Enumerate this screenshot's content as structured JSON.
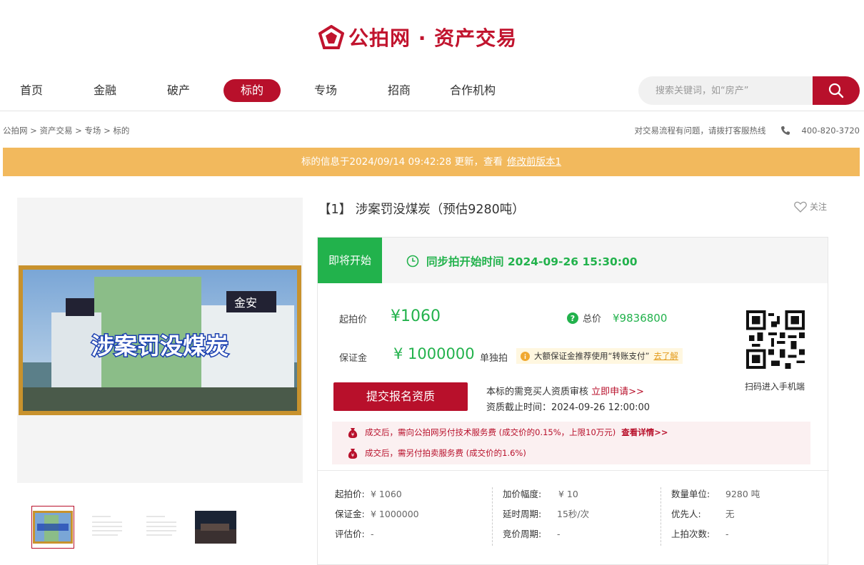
{
  "brand": {
    "logo_text": "公拍网 · 资产交易",
    "accent": "#b8102b",
    "green": "#22b24c",
    "notice_bg": "#f2b95d"
  },
  "nav": {
    "items": [
      {
        "label": "首页"
      },
      {
        "label": "金融"
      },
      {
        "label": "破产"
      },
      {
        "label": "标的",
        "active": true
      },
      {
        "label": "专场"
      },
      {
        "label": "招商"
      },
      {
        "label": "合作机构"
      }
    ],
    "search_placeholder": "搜索关键词，如“房产”"
  },
  "breadcrumb": {
    "items": [
      "公拍网",
      ">",
      "资产交易",
      ">",
      "专场",
      ">",
      "标的"
    ],
    "hotline_text": "对交易流程有问题，请拨打客服热线",
    "phone": "400-820-3720"
  },
  "notice": {
    "text": "标的信息于2024/09/14 09:42:28 更新，查看",
    "link": "修改前版本1"
  },
  "gallery": {
    "main_caption": "涉案罚没煤炭",
    "ship_sign": "金安",
    "thumb_count": 4
  },
  "lot": {
    "title": "【1】 涉案罚没煤炭（预估9280吨）",
    "follow_label": "关注",
    "status": "即将开始",
    "start_time": "同步拍开始时间 2024-09-26 15:30:00",
    "start_price_label": "起拍价",
    "start_price": "¥1060",
    "total_label": "总价",
    "total_price": "¥9836800",
    "deposit_label": "保证金",
    "deposit": "¥ 1000000",
    "single_pay": "单独拍",
    "tip_text": "大额保证金推荐使用“转账支付”",
    "tip_link": "去了解",
    "submit_label": "提交报名资质",
    "review_text": "本标的需竞买人资质审核",
    "review_link": "立即申请>>",
    "deadline": "资质截止时间：2024-09-26 12:00:00",
    "qr_label": "扫码进入手机端",
    "fee1": "成交后，需向公拍网另付技术服务费 (成交价的0.15%，上限10万元)",
    "fee1_link": "查看详情>>",
    "fee2": "成交后，需另付拍卖服务费 (成交价的1.6%)"
  },
  "attrs": {
    "col1": [
      {
        "k": "起拍价:",
        "v": "¥ 1060"
      },
      {
        "k": "保证金:",
        "v": "¥ 1000000"
      },
      {
        "k": "评估价:",
        "v": "-"
      }
    ],
    "col2": [
      {
        "k": "加价幅度:",
        "v": "¥ 10"
      },
      {
        "k": "延时周期:",
        "v": "15秒/次"
      },
      {
        "k": "竞价周期:",
        "v": "-"
      }
    ],
    "col3": [
      {
        "k": "数量单位:",
        "v": "9280 吨"
      },
      {
        "k": "优先人:",
        "v": "无"
      },
      {
        "k": "上拍次数:",
        "v": "-"
      }
    ]
  }
}
